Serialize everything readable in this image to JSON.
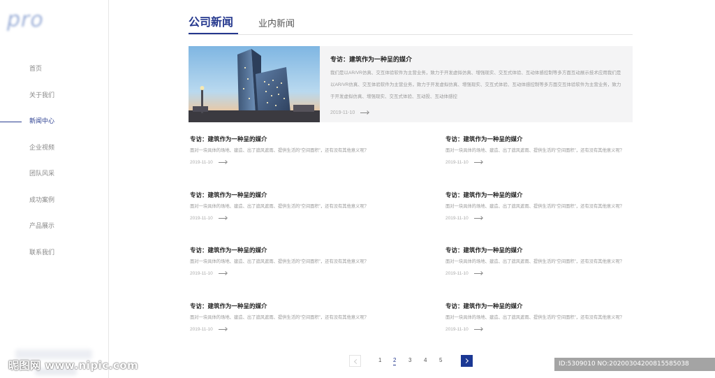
{
  "logo": {
    "text_main": "pro",
    "text_sub": ""
  },
  "sidebar": {
    "items": [
      {
        "label": "首页",
        "active": false
      },
      {
        "label": "关于我们",
        "active": false
      },
      {
        "label": "新闻中心",
        "active": true
      },
      {
        "label": "企业视频",
        "active": false
      },
      {
        "label": "团队风采",
        "active": false
      },
      {
        "label": "成功案例",
        "active": false
      },
      {
        "label": "产品展示",
        "active": false
      },
      {
        "label": "联系我们",
        "active": false
      }
    ]
  },
  "tabs": [
    {
      "label": "公司新闻",
      "active": true
    },
    {
      "label": "业内新闻",
      "active": false
    }
  ],
  "featured": {
    "title": "专访：建筑作为一种呈的媒介",
    "description": "我们是以AR/VR仿真、交互体验软件为主营业务，致力于开发虚拟仿真、增强现实、交互式体验、互动体感控制等多方面互动展示技术应用我们是以AR/VR仿真、交互体验软件为主营业务，致力于开发虚拟仿真、增强现实、交互式体验、互动体感控制等多方面交互体验软件为主营业务，致力于开发虚拟仿真、增强现实、交互式体验、互动投、互动体感控",
    "date": "2019-11-10"
  },
  "news": [
    {
      "title": "专访：建筑作为一种呈的媒介",
      "description": "面对一块具体的场地、建造、出了遮风遮雨、提供生活的“空间面积”，还有没有其他意义呢？",
      "date": "2019-11-10"
    },
    {
      "title": "专访：建筑作为一种呈的媒介",
      "description": "面对一块具体的场地、建造、出了遮风遮雨、提供生活的“空间面积”，还有没有其他意义呢？",
      "date": "2019-11-10"
    },
    {
      "title": "专访：建筑作为一种呈的媒介",
      "description": "面对一块具体的场地、建造、出了遮风遮雨、提供生活的“空间面积”，还有没有其他意义呢？",
      "date": "2019-11-10"
    },
    {
      "title": "专访：建筑作为一种呈的媒介",
      "description": "面对一块具体的场地、建造、出了遮风遮雨、提供生活的“空间面积”，还有没有其他意义呢？",
      "date": "2019-11-10"
    },
    {
      "title": "专访：建筑作为一种呈的媒介",
      "description": "面对一块具体的场地、建造、出了遮风遮雨、提供生活的“空间面积”，还有没有其他意义呢？",
      "date": "2019-11-10"
    },
    {
      "title": "专访：建筑作为一种呈的媒介",
      "description": "面对一块具体的场地、建造、出了遮风遮雨、提供生活的“空间面积”，还有没有其他意义呢？",
      "date": "2019-11-10"
    },
    {
      "title": "专访：建筑作为一种呈的媒介",
      "description": "面对一块具体的场地、建造、出了遮风遮雨、提供生活的“空间面积”，还有没有其他意义呢？",
      "date": "2019-11-10"
    },
    {
      "title": "专访：建筑作为一种呈的媒介",
      "description": "面对一块具体的场地、建造、出了遮风遮雨、提供生活的“空间面积”，还有没有其他意义呢？",
      "date": "2019-11-10"
    }
  ],
  "pagination": {
    "pages": [
      "1",
      "2",
      "3",
      "4",
      "5"
    ],
    "current": "2"
  },
  "watermark": {
    "site": "昵图网 www.nipic.com",
    "id_text": "ID:5309010 NO:20200304200815585038"
  },
  "colors": {
    "accent": "#25388e",
    "pager_next": "#1b3894",
    "featured_bg": "#f4f4f5"
  }
}
